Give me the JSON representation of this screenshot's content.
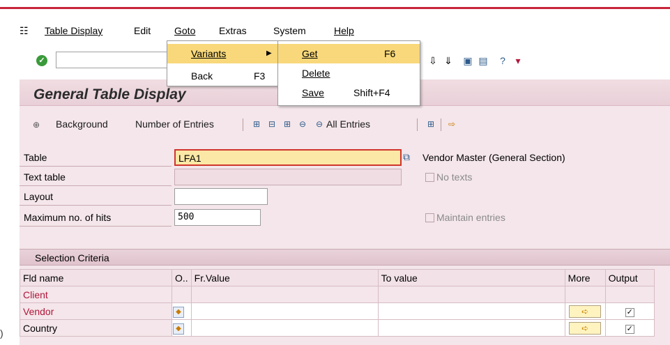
{
  "menubar": {
    "items": [
      "Table Display",
      "Edit",
      "Goto",
      "Extras",
      "System",
      "Help"
    ]
  },
  "goto_menu": {
    "items": [
      {
        "label": "Variants",
        "has_submenu": true
      },
      {
        "label": "Back",
        "shortcut": "F3"
      }
    ]
  },
  "variants_submenu": {
    "items": [
      {
        "label": "Get",
        "shortcut": "F6"
      },
      {
        "label": "Delete",
        "shortcut": ""
      },
      {
        "label": "Save",
        "shortcut": "Shift+F4"
      }
    ]
  },
  "page": {
    "title": "General Table Display"
  },
  "actions": {
    "background": "Background",
    "number_of_entries": "Number of Entries",
    "all_entries": "All Entries"
  },
  "form": {
    "table_label": "Table",
    "table_value": "LFA1",
    "table_description": "Vendor Master (General Section)",
    "text_table_label": "Text table",
    "no_texts_label": "No texts",
    "layout_label": "Layout",
    "max_hits_label": "Maximum no. of hits",
    "max_hits_value": "500",
    "maintain_entries_label": "Maintain entries"
  },
  "selection": {
    "title": "Selection Criteria",
    "columns": [
      "Fld name",
      "O..",
      "Fr.Value",
      "To value",
      "More",
      "Output"
    ],
    "rows": [
      {
        "name": "Client",
        "option_icon": false,
        "more": false,
        "output": false
      },
      {
        "name": "Vendor",
        "option_icon": true,
        "more": true,
        "output": true
      },
      {
        "name": "Country",
        "option_icon": true,
        "more": true,
        "output": true
      }
    ]
  },
  "colors": {
    "accent": "#c8263a",
    "panel_bg": "#f4e6ea",
    "highlight": "#f8d87a"
  }
}
